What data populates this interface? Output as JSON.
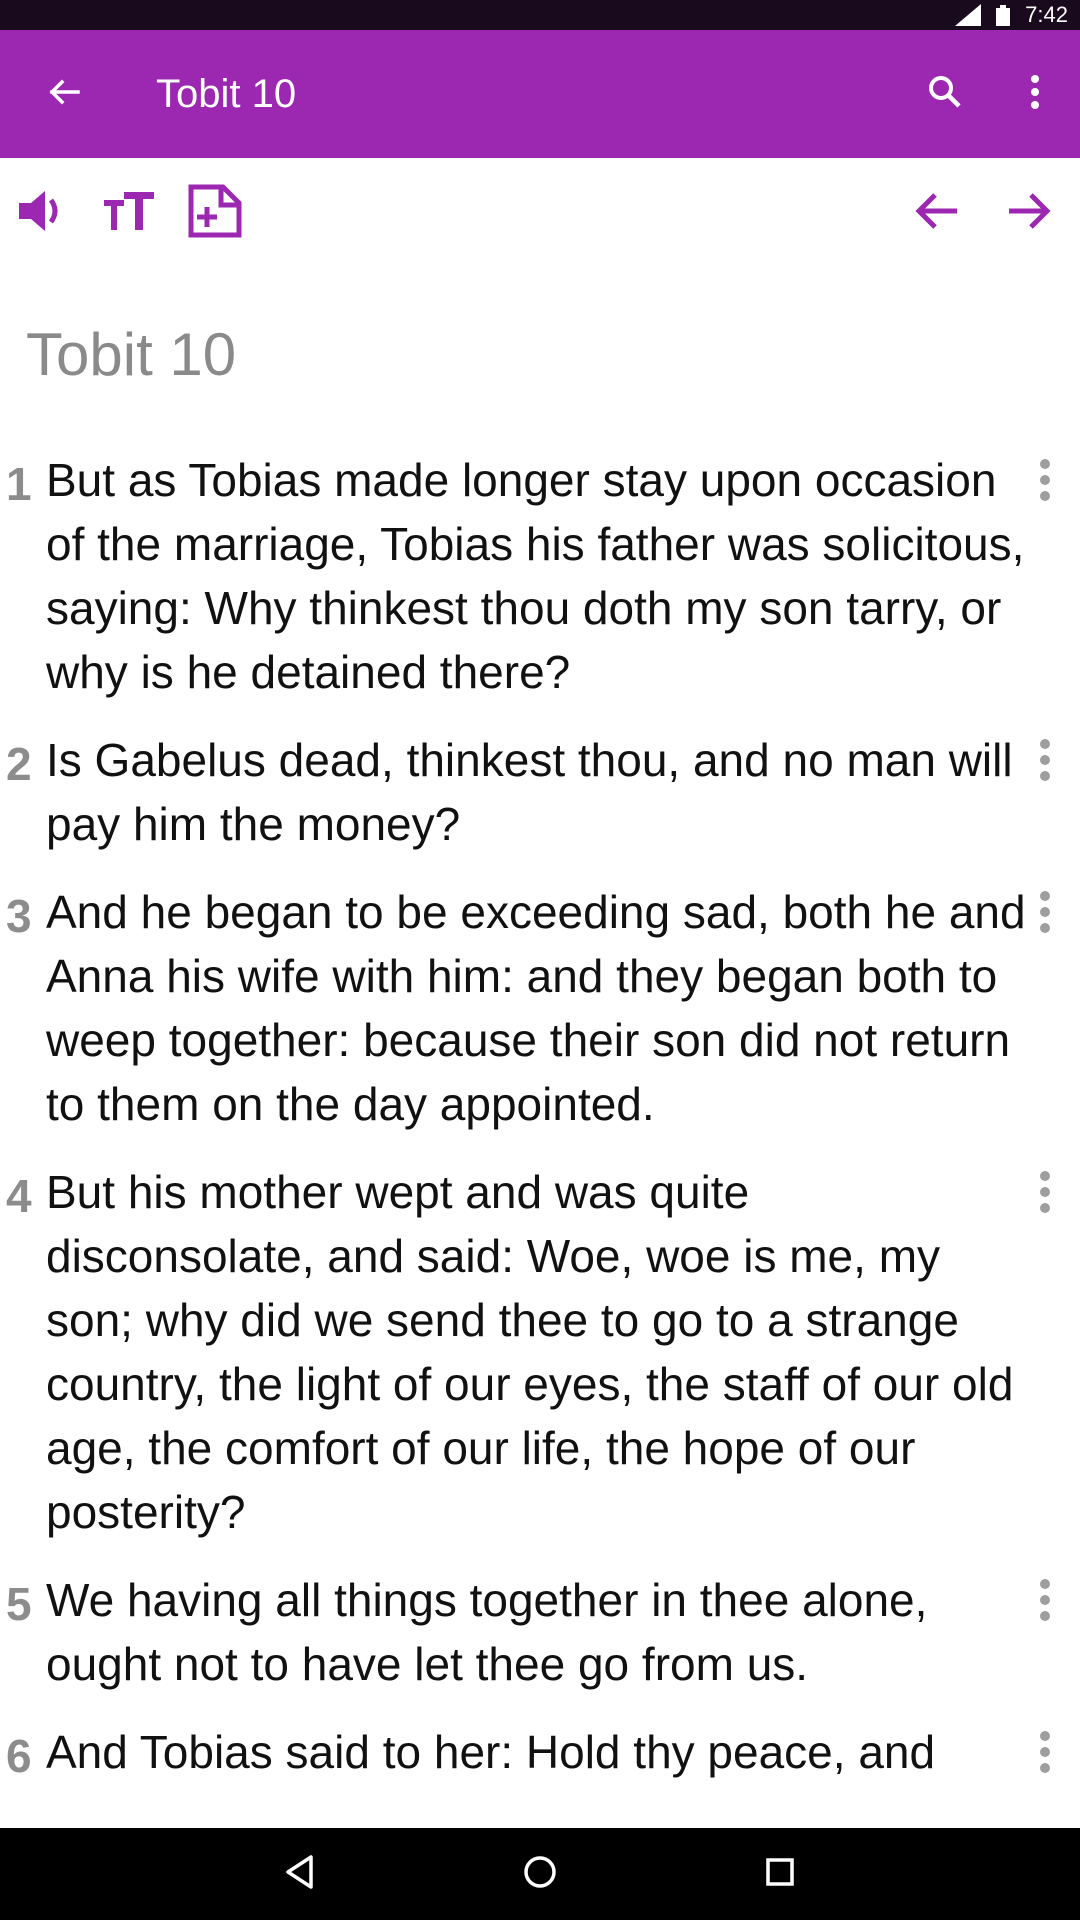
{
  "status_bar": {
    "time": "7:42"
  },
  "app_bar": {
    "title": "Tobit 10"
  },
  "chapter": {
    "heading": "Tobit 10"
  },
  "colors": {
    "accent": "#9c27b0",
    "verse_number": "#8c8c8c"
  },
  "icons": {
    "toolbar": [
      "speaker-icon",
      "text-size-icon",
      "add-note-icon",
      "previous-arrow-icon",
      "next-arrow-icon"
    ],
    "app_bar": [
      "back-arrow-icon",
      "search-icon",
      "more-vert-icon"
    ],
    "nav": [
      "nav-back-icon",
      "nav-home-icon",
      "nav-recents-icon"
    ]
  },
  "verses": [
    {
      "num": "1",
      "text": "But as Tobias made longer stay upon occasion of the marriage, Tobias his father was solicitous, saying: Why thinkest thou doth my son tarry, or why is he detained there?"
    },
    {
      "num": "2",
      "text": "Is Gabelus dead, thinkest thou, and no man will pay him the money?"
    },
    {
      "num": "3",
      "text": "And he began to be exceeding sad, both he and Anna his wife with him: and they began both to weep together: because their son did not return to them on the day appointed."
    },
    {
      "num": "4",
      "text": "But his mother wept and was quite disconsolate, and said: Woe, woe is me, my son; why did we send thee to go to a strange country, the light of our eyes, the staff of our old age, the comfort of our life, the hope of our posterity?"
    },
    {
      "num": "5",
      "text": "We having all things together in thee alone, ought not to have let thee go from us."
    },
    {
      "num": "6",
      "text": "And Tobias said to her: Hold thy peace, and"
    }
  ]
}
